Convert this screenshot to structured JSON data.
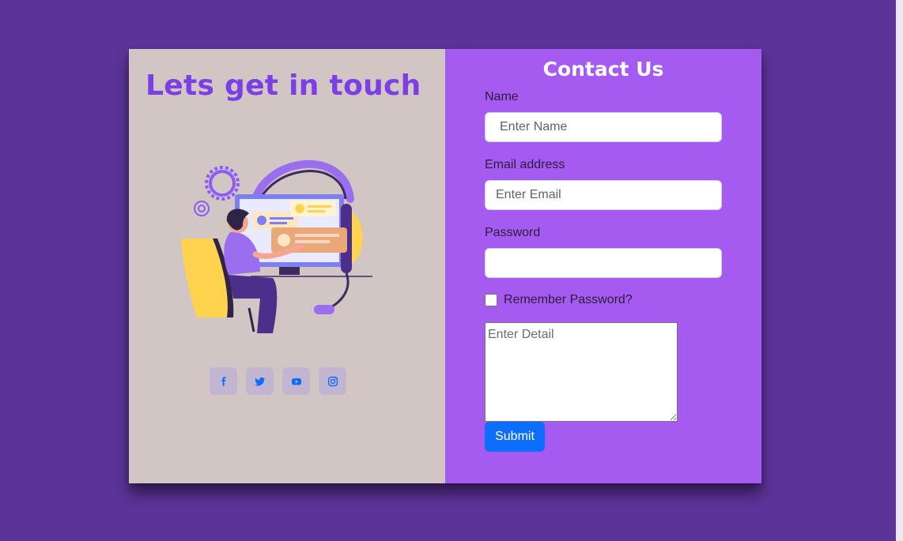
{
  "left": {
    "heading": "Lets get in touch",
    "illustration_name": "support-agent-illustration",
    "social": [
      {
        "name": "facebook",
        "icon": "facebook-icon"
      },
      {
        "name": "twitter",
        "icon": "twitter-icon"
      },
      {
        "name": "youtube",
        "icon": "youtube-icon"
      },
      {
        "name": "instagram",
        "icon": "instagram-icon"
      }
    ]
  },
  "form": {
    "title": "Contact Us",
    "name_label": "Name",
    "name_placeholder": "Enter Name",
    "name_value": "",
    "email_label": "Email address",
    "email_placeholder": "Enter Email",
    "email_value": "",
    "password_label": "Password",
    "password_value": "",
    "remember_label": "Remember Password?",
    "remember_checked": false,
    "detail_placeholder": "Enter Detail",
    "detail_value": "",
    "submit_label": "Submit"
  },
  "colors": {
    "page_bg": "#5c3399",
    "left_panel_bg": "#d2c6c5",
    "right_panel_bg": "#a55bef",
    "heading": "#7b3fe4",
    "submit_bg": "#0d6efd",
    "social_icon": "#0d6efd"
  }
}
